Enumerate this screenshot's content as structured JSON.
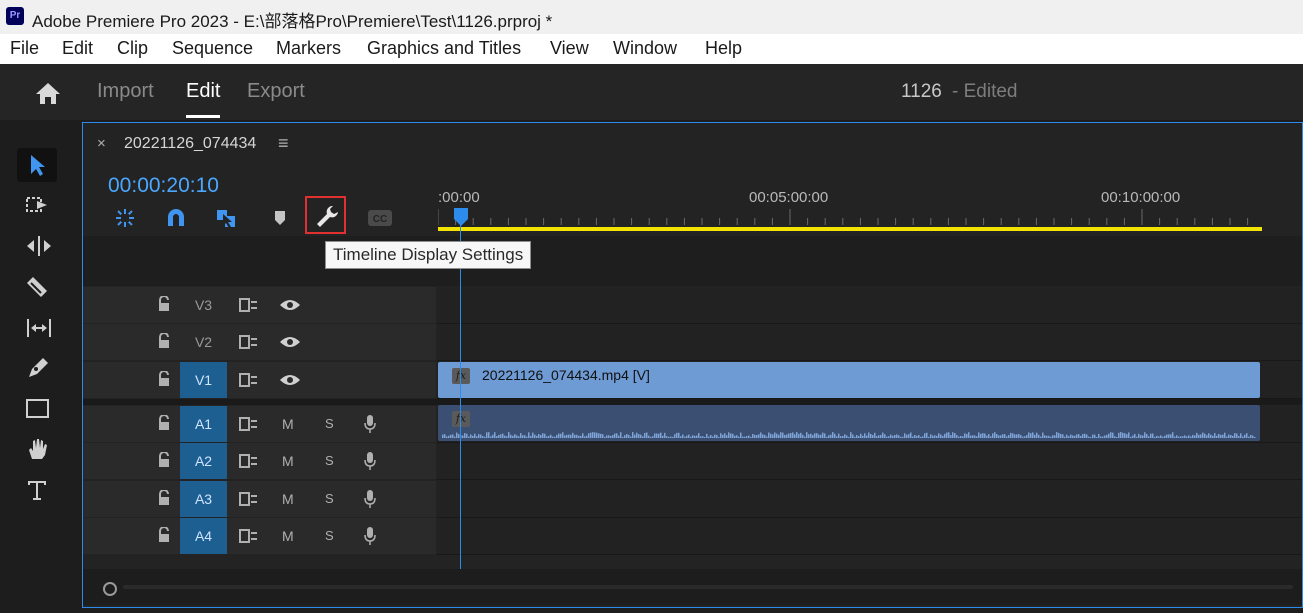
{
  "titlebar": {
    "logo": "Pr",
    "title": "Adobe Premiere Pro 2023 - E:\\部落格Pro\\Premiere\\Test\\1126.prproj *"
  },
  "menu": [
    "File",
    "Edit",
    "Clip",
    "Sequence",
    "Markers",
    "Graphics and Titles",
    "View",
    "Window",
    "Help"
  ],
  "header": {
    "home_icon": "home-icon",
    "tabs": [
      "Import",
      "Edit",
      "Export"
    ],
    "active_tab": "Edit",
    "document_name": "1126",
    "document_status": " - Edited"
  },
  "tools": [
    "selection-tool",
    "track-select-tool",
    "ripple-edit-tool",
    "razor-tool",
    "slip-tool",
    "pen-tool",
    "rectangle-tool",
    "hand-tool",
    "type-tool"
  ],
  "timeline": {
    "close_glyph": "×",
    "sequence_name": "20221126_074434",
    "menu_glyph": "≡",
    "timecode": "00:00:20:10",
    "toolbar_icons": [
      "nest-icon",
      "snap-magnet-icon",
      "linked-selection-icon",
      "add-marker-icon",
      "wrench-icon",
      "captions-icon"
    ],
    "captions_label": "CC",
    "ruler_labels": [
      ":00:00",
      "00:05:00:00",
      "00:10:00:00"
    ],
    "tooltip": "Timeline Display Settings",
    "video_tracks": [
      {
        "label": "V3",
        "targeted": false
      },
      {
        "label": "V2",
        "targeted": false
      },
      {
        "label": "V1",
        "targeted": true
      }
    ],
    "audio_tracks": [
      {
        "label": "A1",
        "targeted": true,
        "mute": "M",
        "solo": "S"
      },
      {
        "label": "A2",
        "targeted": true,
        "mute": "M",
        "solo": "S"
      },
      {
        "label": "A3",
        "targeted": true,
        "mute": "M",
        "solo": "S"
      },
      {
        "label": "A4",
        "targeted": true,
        "mute": "M",
        "solo": "S"
      }
    ],
    "video_clip": {
      "name": "20221126_074434.mp4 [V]",
      "fx": "fx"
    },
    "audio_clip": {
      "fx": "fx"
    },
    "colors": {
      "accent": "#2d8ceb",
      "timecode": "#4aa7ff",
      "work_area": "#f2e300",
      "video_clip": "#6f9bd4",
      "audio_clip": "#3a4f72",
      "track_target": "#1e5f92",
      "highlight": "#e03030"
    }
  }
}
